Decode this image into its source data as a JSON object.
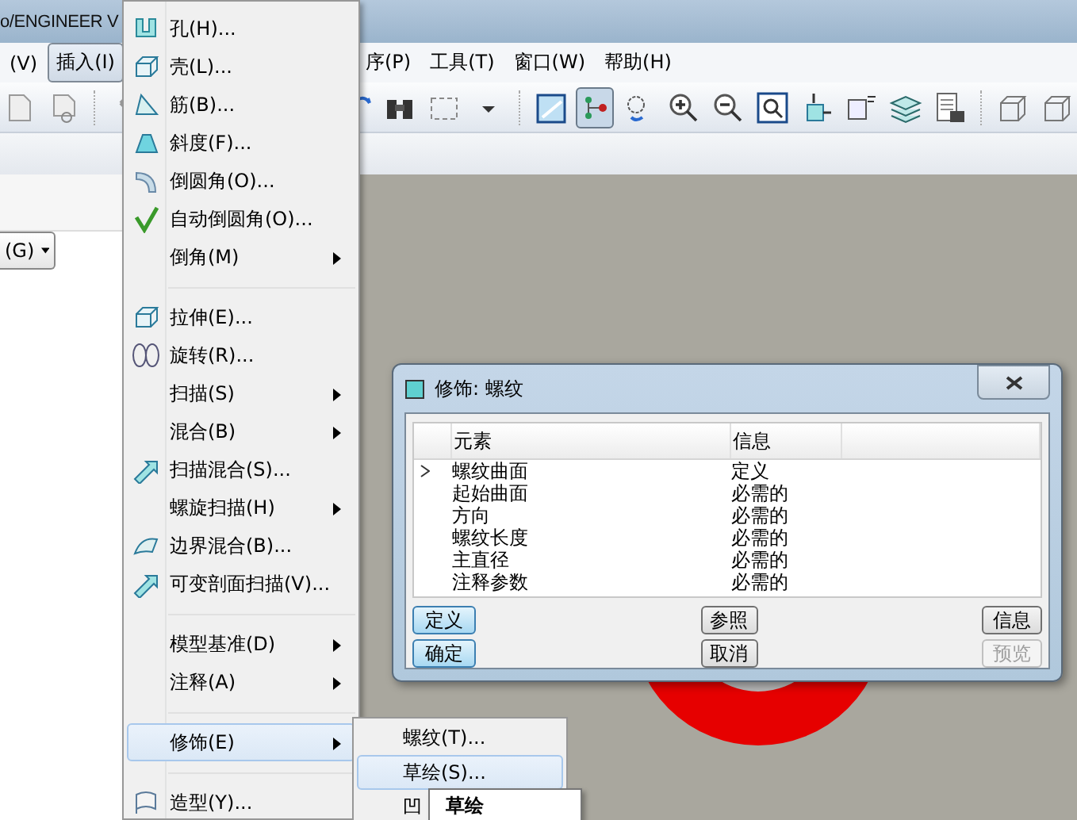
{
  "window": {
    "title": "o/ENGINEER V"
  },
  "menubar": [
    {
      "label": "(V)",
      "selected": false
    },
    {
      "label": "插入(I)",
      "selected": true
    },
    {
      "label": "序(P)",
      "selected": false
    },
    {
      "label": "工具(T)",
      "selected": false
    },
    {
      "label": "窗口(W)",
      "selected": false
    },
    {
      "label": "帮助(H)",
      "selected": false
    }
  ],
  "toolbar_left": [
    {
      "kind": "page",
      "pressed": false
    },
    {
      "kind": "page-link",
      "pressed": false
    },
    {
      "kind": "separator"
    },
    {
      "kind": "undo",
      "pressed": false
    }
  ],
  "toolbar_right": [
    {
      "kind": "regen",
      "pressed": false
    },
    {
      "kind": "binoculars",
      "pressed": false
    },
    {
      "kind": "select-box",
      "pressed": false
    },
    {
      "kind": "caret",
      "pressed": false
    },
    {
      "kind": "separator"
    },
    {
      "kind": "display",
      "pressed": false
    },
    {
      "kind": "points",
      "pressed": true
    },
    {
      "kind": "spin",
      "pressed": false
    },
    {
      "kind": "zoom-in",
      "pressed": false
    },
    {
      "kind": "zoom-out",
      "pressed": false
    },
    {
      "kind": "refit",
      "pressed": false
    },
    {
      "kind": "orient",
      "pressed": false
    },
    {
      "kind": "views",
      "pressed": false
    },
    {
      "kind": "layers",
      "pressed": false
    },
    {
      "kind": "table",
      "pressed": false
    },
    {
      "kind": "separator"
    },
    {
      "kind": "cube",
      "pressed": false
    },
    {
      "kind": "cube",
      "pressed": false
    }
  ],
  "filter": {
    "value": "(G)"
  },
  "insert_menu": [
    {
      "kind": "item",
      "label": "孔(H)...",
      "submenu": false,
      "selected": false
    },
    {
      "kind": "item",
      "label": "壳(L)...",
      "submenu": false,
      "selected": false
    },
    {
      "kind": "item",
      "label": "筋(B)...",
      "submenu": false,
      "selected": false
    },
    {
      "kind": "item",
      "label": "斜度(F)...",
      "submenu": false,
      "selected": false
    },
    {
      "kind": "item",
      "label": "倒圆角(O)...",
      "submenu": false,
      "selected": false
    },
    {
      "kind": "item",
      "label": "自动倒圆角(O)...",
      "submenu": false,
      "selected": false
    },
    {
      "kind": "item",
      "label": "倒角(M)",
      "submenu": true,
      "selected": false
    },
    {
      "kind": "separator"
    },
    {
      "kind": "item",
      "label": "拉伸(E)...",
      "submenu": false,
      "selected": false
    },
    {
      "kind": "item",
      "label": "旋转(R)...",
      "submenu": false,
      "selected": false
    },
    {
      "kind": "item",
      "label": "扫描(S)",
      "submenu": true,
      "selected": false
    },
    {
      "kind": "item",
      "label": "混合(B)",
      "submenu": true,
      "selected": false
    },
    {
      "kind": "item",
      "label": "扫描混合(S)...",
      "submenu": false,
      "selected": false
    },
    {
      "kind": "item",
      "label": "螺旋扫描(H)",
      "submenu": true,
      "selected": false
    },
    {
      "kind": "item",
      "label": "边界混合(B)...",
      "submenu": false,
      "selected": false
    },
    {
      "kind": "item",
      "label": "可变剖面扫描(V)...",
      "submenu": false,
      "selected": false
    },
    {
      "kind": "separator"
    },
    {
      "kind": "item",
      "label": "模型基准(D)",
      "submenu": true,
      "selected": false
    },
    {
      "kind": "item",
      "label": "注释(A)",
      "submenu": true,
      "selected": false
    },
    {
      "kind": "separator"
    },
    {
      "kind": "item",
      "label": "修饰(E)",
      "submenu": true,
      "selected": true
    },
    {
      "kind": "separator"
    },
    {
      "kind": "item",
      "label": "造型(Y)...",
      "submenu": false,
      "selected": false
    }
  ],
  "cosmetic_menu": [
    {
      "label": "螺纹(T)...",
      "selected": false
    },
    {
      "label": "草绘(S)...",
      "selected": true
    },
    {
      "label": "凹",
      "selected": false
    }
  ],
  "tooltip": {
    "text": "草绘"
  },
  "dialog": {
    "title": "修饰: 螺纹",
    "columns": [
      "元素",
      "信息"
    ],
    "rows": [
      {
        "element": "螺纹曲面",
        "info": "定义",
        "current": true
      },
      {
        "element": "起始曲面",
        "info": "必需的",
        "current": false
      },
      {
        "element": "方向",
        "info": "必需的",
        "current": false
      },
      {
        "element": "螺纹长度",
        "info": "必需的",
        "current": false
      },
      {
        "element": "主直径",
        "info": "必需的",
        "current": false
      },
      {
        "element": "注释参数",
        "info": "必需的",
        "current": false
      }
    ],
    "buttons": [
      {
        "label": "定义",
        "highlighted": true,
        "disabled": false
      },
      {
        "label": "参照",
        "highlighted": false,
        "disabled": false
      },
      {
        "label": "信息",
        "highlighted": false,
        "disabled": false
      },
      {
        "label": "确定",
        "highlighted": true,
        "disabled": false
      },
      {
        "label": "取消",
        "highlighted": false,
        "disabled": false
      },
      {
        "label": "预览",
        "highlighted": false,
        "disabled": true
      }
    ]
  }
}
